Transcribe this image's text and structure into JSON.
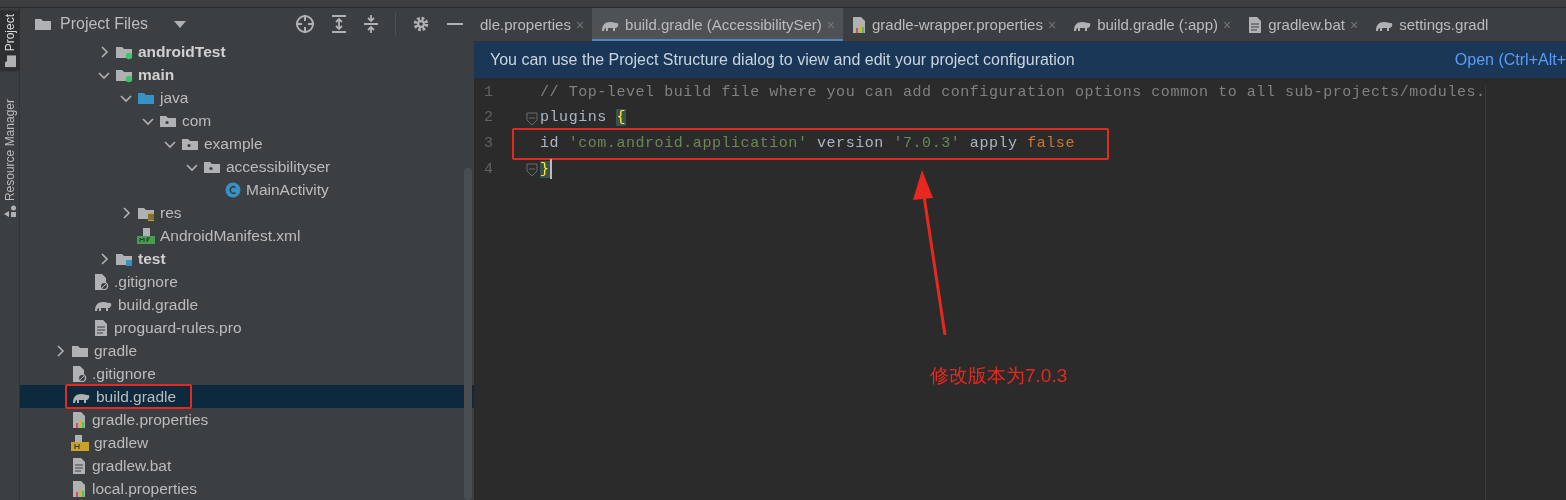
{
  "tool_window_tabs": [
    {
      "label": "Project",
      "kind": "folder",
      "selected": true
    },
    {
      "label": "Resource Manager",
      "kind": "resources",
      "selected": false
    }
  ],
  "project_panel": {
    "view": "Project Files",
    "tree": [
      {
        "children": [
          {
            "children": [
              {
                "label": "androidTest",
                "kind": "module-folder",
                "bold": true,
                "expanded": false,
                "selected": false
              },
              {
                "label": "main",
                "kind": "module-folder",
                "bold": true,
                "expanded": true,
                "selected": false,
                "children": [
                  {
                    "label": "java",
                    "kind": "source-folder",
                    "expanded": true,
                    "selected": false,
                    "children": [
                      {
                        "label": "com",
                        "kind": "package",
                        "expanded": true,
                        "selected": false,
                        "children": [
                          {
                            "label": "example",
                            "kind": "package",
                            "expanded": true,
                            "selected": false,
                            "children": [
                              {
                                "label": "accessibilityser",
                                "kind": "package",
                                "expanded": true,
                                "selected": false,
                                "children": [
                                  {
                                    "label": "MainActivity",
                                    "kind": "class",
                                    "selected": false
                                  }
                                ]
                              }
                            ]
                          }
                        ]
                      }
                    ]
                  },
                  {
                    "label": "res",
                    "kind": "resource-folder",
                    "expanded": false,
                    "selected": false
                  },
                  {
                    "label": "AndroidManifest.xml",
                    "kind": "manifest",
                    "selected": false
                  }
                ]
              },
              {
                "label": "test",
                "kind": "test-folder",
                "bold": true,
                "expanded": false,
                "selected": false
              }
            ]
          },
          {
            "label": ".gitignore",
            "kind": "ignore-file",
            "selected": false
          },
          {
            "label": "build.gradle",
            "kind": "gradle",
            "selected": false
          },
          {
            "label": "proguard-rules.pro",
            "kind": "text-file",
            "selected": false
          }
        ]
      },
      {
        "label": "gradle",
        "kind": "folder",
        "expanded": false,
        "selected": false
      },
      {
        "label": ".gitignore",
        "kind": "ignore-file",
        "selected": false
      },
      {
        "label": "build.gradle",
        "kind": "gradle",
        "selected": true,
        "highlighted": true
      },
      {
        "label": "gradle.properties",
        "kind": "properties",
        "selected": false
      },
      {
        "label": "gradlew",
        "kind": "shell-script",
        "selected": false
      },
      {
        "label": "gradlew.bat",
        "kind": "text-file",
        "selected": false
      },
      {
        "label": "local.properties",
        "kind": "properties",
        "selected": false
      }
    ]
  },
  "editor_tabs": [
    {
      "label": "dle.properties",
      "close": "×",
      "selected": false
    },
    {
      "label": "build.gradle (AccessibilitySer)",
      "kind": "gradle",
      "close": "×",
      "selected": true
    },
    {
      "label": "gradle-wrapper.properties",
      "kind": "properties",
      "close": "×",
      "selected": false
    },
    {
      "label": "build.gradle (:app)",
      "kind": "gradle",
      "close": "×",
      "selected": false
    },
    {
      "label": "gradlew.bat",
      "kind": "text-file",
      "close": "×",
      "selected": false
    },
    {
      "label": "settings.gradl",
      "kind": "gradle",
      "selected": false
    }
  ],
  "banner": {
    "text": "You can use the Project Structure dialog to view and edit your project configuration",
    "link": "Open (Ctrl+Alt+"
  },
  "code_lines": [
    {
      "number": "1",
      "tokens": [
        {
          "text": "// Top-level build file where you can add configuration options common to all sub-projects/modules.",
          "kind": "comment"
        }
      ]
    },
    {
      "number": "2",
      "fold": true,
      "tokens": [
        {
          "text": "plugins ",
          "kind": "plain"
        },
        {
          "text": "{",
          "kind": "brace-match"
        }
      ]
    },
    {
      "number": "3",
      "highlighted": true,
      "tokens": [
        {
          "text": "id ",
          "kind": "plain"
        },
        {
          "text": "'com.android.application'",
          "kind": "string"
        },
        {
          "text": " version ",
          "kind": "plain"
        },
        {
          "text": "'7.0.3'",
          "kind": "string"
        },
        {
          "text": " apply ",
          "kind": "plain"
        },
        {
          "text": "false",
          "kind": "keyword"
        }
      ]
    },
    {
      "number": "4",
      "fold": true,
      "cursor": true,
      "tokens": [
        {
          "text": "}",
          "kind": "brace-match"
        }
      ]
    }
  ],
  "annotation": {
    "text": "修改版本为7.0.3"
  }
}
